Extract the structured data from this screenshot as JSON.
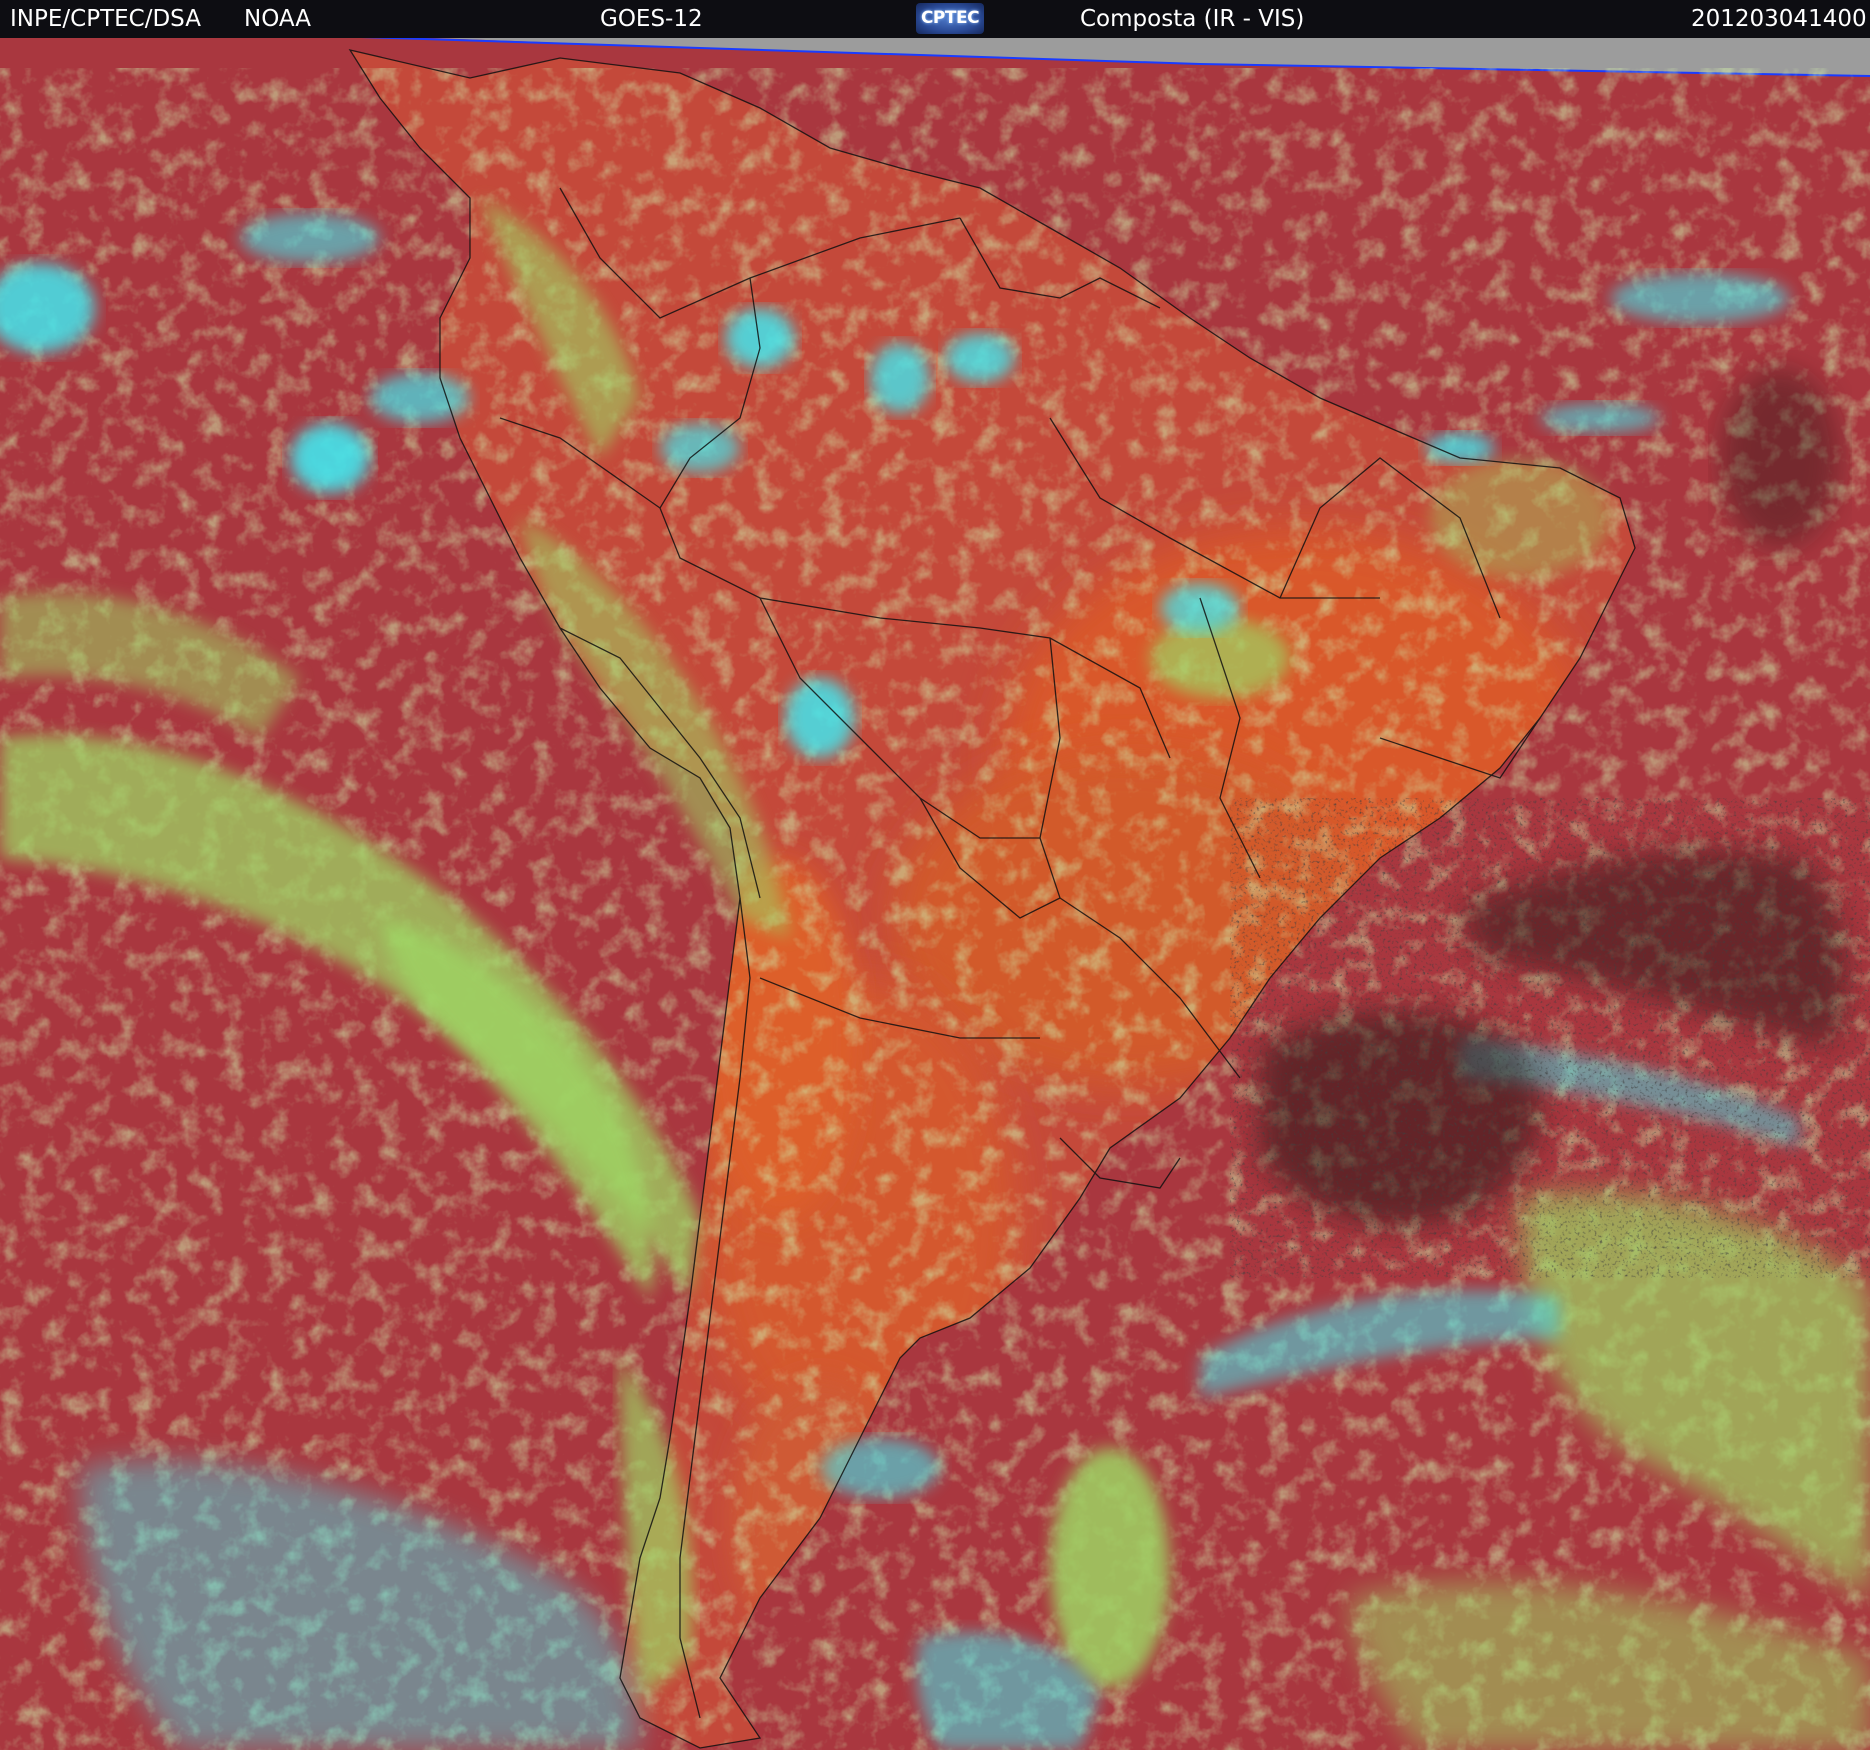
{
  "header": {
    "institution": "INPE/CPTEC/DSA",
    "agency": "NOAA",
    "satellite": "GOES-12",
    "logo_text": "CPTEC",
    "product": "Composta (IR - VIS)",
    "timestamp": "201203041400"
  },
  "colors": {
    "header_background": "#0d0d12",
    "ocean_clear": "#a9373f",
    "land_clear": "#d4572a",
    "low_cloud": "#9ed464",
    "high_cold_cloud": "#43e6ee",
    "very_clear": "#1a1a1a",
    "no_data": "#9c9c9c",
    "border_lines": "#000000",
    "edge_line": "#1a3cff"
  }
}
